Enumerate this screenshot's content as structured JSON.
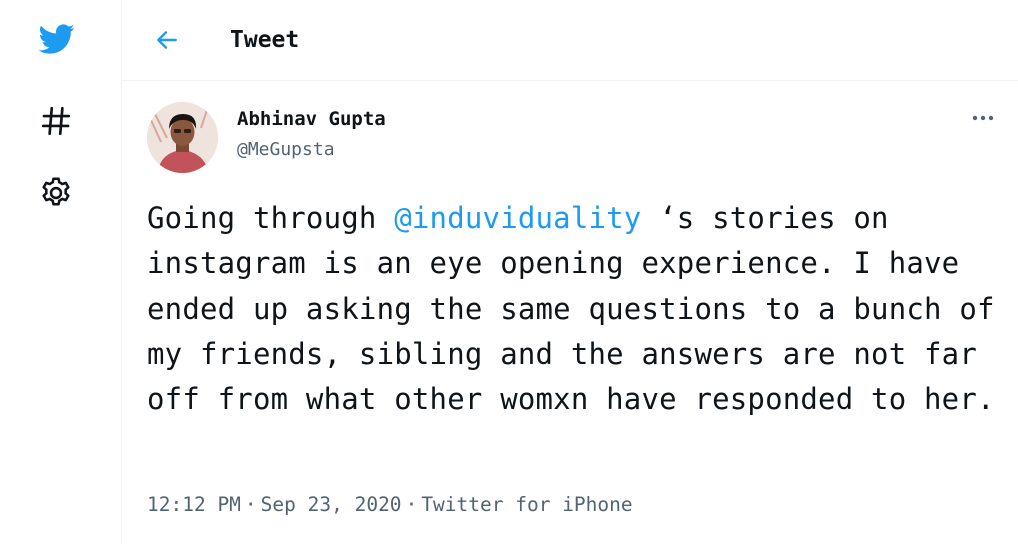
{
  "nav": {
    "logo": "twitter-bird-icon",
    "explore": "hashtag-icon",
    "settings": "gear-icon"
  },
  "header": {
    "back_icon": "arrow-left-icon",
    "title": "Tweet"
  },
  "tweet": {
    "author": {
      "name": "Abhinav Gupta",
      "handle": "@MeGupsta"
    },
    "more_icon": "more-dots-icon",
    "text": {
      "before_mention": "Going through ",
      "mention": "@induviduality",
      "after_mention": " ‘s stories on instagram is an eye opening experience. I have ended up asking the same questions to a bunch of my friends, sibling and the answers are not far off from what other womxn have responded to her."
    },
    "time": "12:12 PM",
    "separator_1": "·",
    "date": "Sep 23, 2020",
    "separator_2": "·",
    "source": "Twitter for iPhone"
  },
  "colors": {
    "brand": "#1d9bf0",
    "text": "#0f1419",
    "secondary": "#536471",
    "divider": "#eff3f4"
  }
}
